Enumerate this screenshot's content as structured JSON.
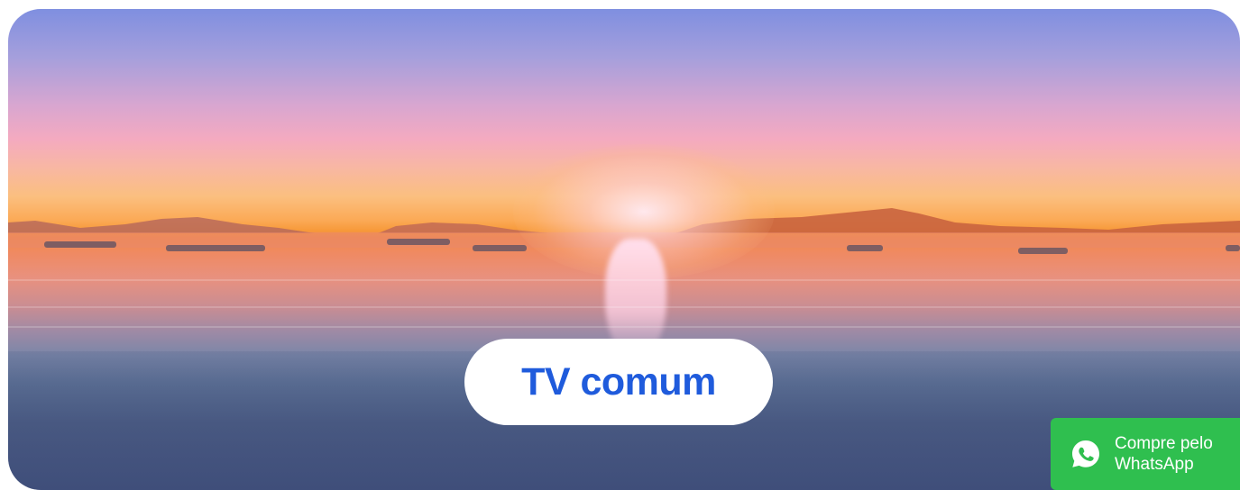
{
  "hero": {
    "image_description_icon": "sunset-beach-photo",
    "title": "TV comum",
    "title_color": "#1f5bdc"
  },
  "whatsapp": {
    "line1": "Compre pelo",
    "line2": "WhatsApp",
    "icon": "whatsapp-icon",
    "color": "#2fbf4f"
  }
}
